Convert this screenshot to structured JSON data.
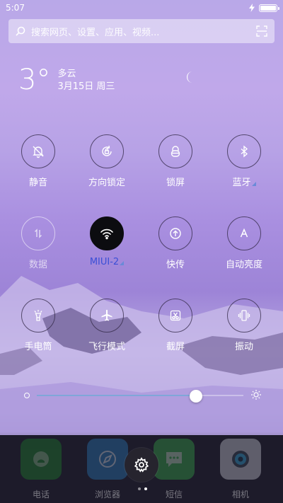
{
  "status_bar": {
    "time": "5:07",
    "battery_level": 1.0
  },
  "search": {
    "placeholder": "搜索网页、设置、应用、视频..."
  },
  "weather": {
    "temperature": "3°",
    "condition": "多云",
    "date": "3月15日 周三"
  },
  "toggles": [
    {
      "label": "静音",
      "icon": "mute-bell-icon",
      "state": "off"
    },
    {
      "label": "方向锁定",
      "icon": "rotation-lock-icon",
      "state": "off"
    },
    {
      "label": "锁屏",
      "icon": "lock-icon",
      "state": "off"
    },
    {
      "label": "蓝牙",
      "icon": "bluetooth-icon",
      "state": "off",
      "has_more": true
    },
    {
      "label": "数据",
      "icon": "mobile-data-icon",
      "state": "disabled"
    },
    {
      "label": "MIUI-2",
      "icon": "wifi-icon",
      "state": "on",
      "has_more": true
    },
    {
      "label": "快传",
      "icon": "quick-transfer-icon",
      "state": "off"
    },
    {
      "label": "自动亮度",
      "icon": "auto-brightness-icon",
      "state": "off"
    },
    {
      "label": "手电筒",
      "icon": "flashlight-icon",
      "state": "off"
    },
    {
      "label": "飞行模式",
      "icon": "airplane-icon",
      "state": "off"
    },
    {
      "label": "截屏",
      "icon": "screenshot-icon",
      "state": "off"
    },
    {
      "label": "振动",
      "icon": "vibrate-icon",
      "state": "off"
    }
  ],
  "brightness": {
    "level": 0.77
  },
  "dock": [
    {
      "label": "电话",
      "icon": "phone-icon",
      "color": "#1d8a2a"
    },
    {
      "label": "浏览器",
      "icon": "browser-icon",
      "color": "#2a84c8"
    },
    {
      "label": "短信",
      "icon": "messages-icon",
      "color": "#39b54a"
    },
    {
      "label": "相机",
      "icon": "camera-icon",
      "color": "#d9dce4"
    }
  ],
  "page_indicator": {
    "count": 2,
    "current": 1
  }
}
